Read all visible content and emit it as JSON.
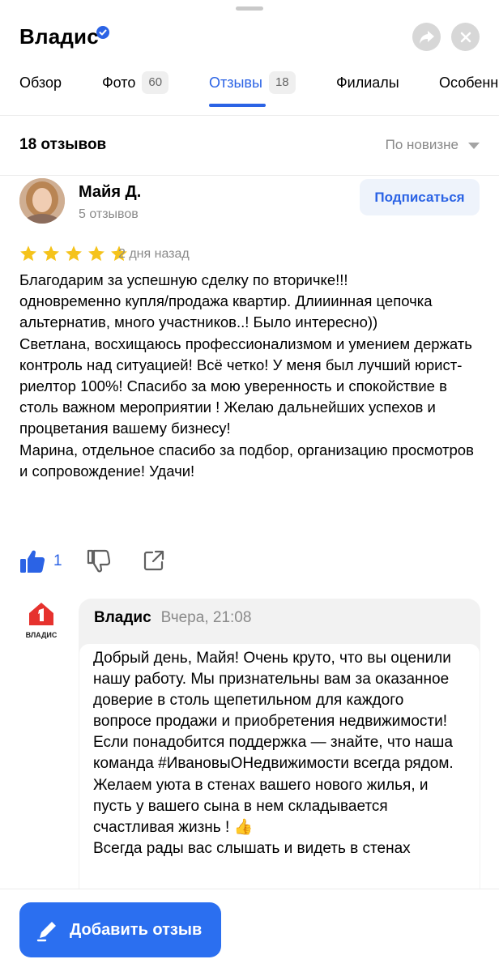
{
  "header": {
    "title": "Владис",
    "verified_icon": "verified-check-icon",
    "share_icon": "share-arrow-icon",
    "close_icon": "close-icon"
  },
  "tabs": [
    {
      "label": "Обзор"
    },
    {
      "label": "Фото",
      "badge": "60"
    },
    {
      "label": "Отзывы",
      "badge": "18",
      "active": true
    },
    {
      "label": "Филиалы"
    },
    {
      "label": "Особенности"
    }
  ],
  "reviews_header": {
    "count": "18 отзывов",
    "sort": "По новизне"
  },
  "review": {
    "author": "Майя Д.",
    "author_reviews": "5 отзывов",
    "subscribe": "Подписаться",
    "rating": 5,
    "date": "2 дня назад",
    "text": "Благодарим за успешную сделку по вторичке!!!\nодновременно купля/продажа квартир. Длииинная цепочка альтернатив, много участников..! Было интересно))\nСветлана, восхищаюсь профессионализмом и умением держать контроль над ситуацией! Всё четко! У меня был лучший юрист-риелтор 100%! Спасибо за мою уверенность и спокойствие в столь важном мероприятии ! Желаю дальнейших успехов и процветания вашему бизнесу!\nМарина, отдельное спасибо за подбор, организацию просмотров и сопровождение! Удачи!",
    "likes": "1"
  },
  "reply": {
    "logo_text": "ВЛАДИС",
    "name": "Владис",
    "time": "Вчера, 21:08",
    "text": "Добрый день, Майя! Очень круто, что вы оценили нашу работу. Мы признательны вам за оказанное доверие в столь щепетильном для каждого вопросе продажи и приобретения недвижимости! Если понадобится поддержка — знайте, что наша команда #ИвановыОНедвижимости всегда рядом. Желаем уюта в стенах вашего нового жилья, и пусть у вашего сына в нем складывается счастливая жизнь ! 👍\nВсегда рады вас слышать и видеть в стенах"
  },
  "footer": {
    "add_review": "Добавить отзыв"
  },
  "colors": {
    "accent": "#2b63e5",
    "star": "#f5c31b",
    "button": "#2b6ff0",
    "logo_red": "#e6322e"
  }
}
